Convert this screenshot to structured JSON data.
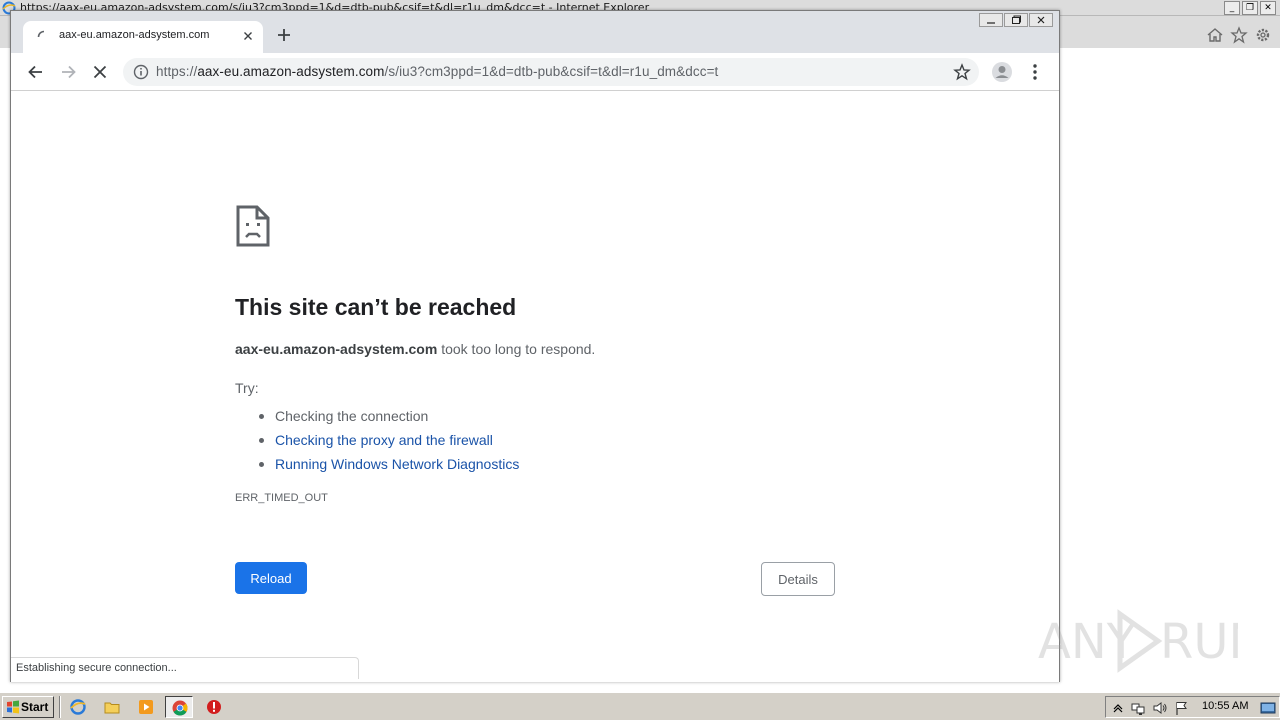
{
  "ie_window": {
    "title": "https://aax-eu.amazon-adsystem.com/s/iu3?cm3ppd=1&d=dtb-pub&csif=t&dl=r1u_dm&dcc=t - Internet Explorer",
    "controls": [
      "minimize",
      "restore",
      "close"
    ],
    "toolbar_icons": [
      "home-icon",
      "star-icon",
      "gear-icon"
    ]
  },
  "chrome": {
    "tab": {
      "title": "aax-eu.amazon-adsystem.com"
    },
    "address": {
      "scheme": "https://",
      "host": "aax-eu.amazon-adsystem.com",
      "path": "/s/iu3?cm3ppd=1&d=dtb-pub&csif=t&dl=r1u_dm&dcc=t"
    }
  },
  "error_page": {
    "title": "This site can’t be reached",
    "host": "aax-eu.amazon-adsystem.com",
    "message": " took too long to respond.",
    "try_label": "Try:",
    "suggestions": [
      {
        "text": "Checking the connection",
        "link": false
      },
      {
        "text": "Checking the proxy and the firewall",
        "link": true
      },
      {
        "text": "Running Windows Network Diagnostics",
        "link": true
      }
    ],
    "error_code": "ERR_TIMED_OUT",
    "reload_label": "Reload",
    "details_label": "Details"
  },
  "status_bar": {
    "text": "Establishing secure connection..."
  },
  "watermark": {
    "text_left": "ANY",
    "text_right": "RUN"
  },
  "taskbar": {
    "start_label": "Start",
    "clock": "10:55 AM"
  },
  "colors": {
    "link": "#1a53a8",
    "primary_button": "#1a73e8",
    "tabstrip": "#dee1e6"
  }
}
